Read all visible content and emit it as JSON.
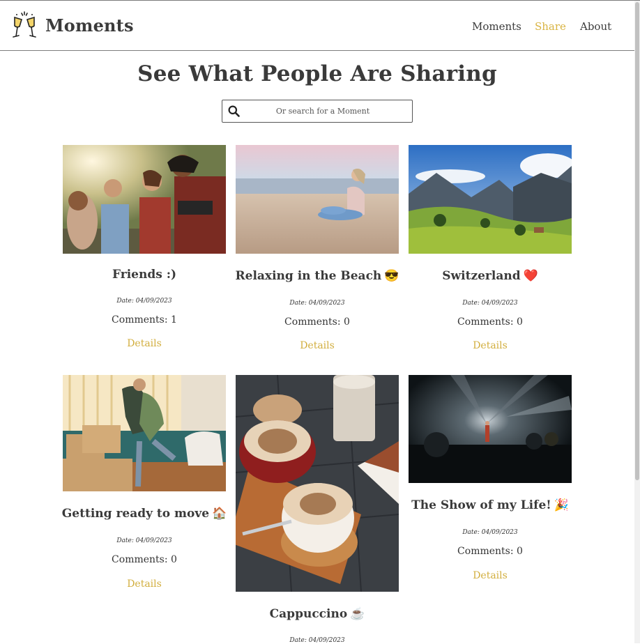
{
  "app": {
    "name": "Moments"
  },
  "nav": [
    {
      "label": "Moments",
      "active": false
    },
    {
      "label": "Share",
      "active": true
    },
    {
      "label": "About",
      "active": false
    }
  ],
  "page": {
    "title": "See What People Are Sharing"
  },
  "search": {
    "placeholder": "Or search for a Moment",
    "value": ""
  },
  "colors": {
    "accent": "#d9b443",
    "text": "#3a3a3a",
    "border": "#7d7d7d"
  },
  "cards": [
    {
      "title": "Friends :)",
      "emoji": "",
      "date": "Date: 04/09/2023",
      "comments": "Comments: 1",
      "details": "Details",
      "photo": "group of friends laughing outdoors"
    },
    {
      "title": "Relaxing in the Beach",
      "emoji": "😎",
      "date": "Date: 04/09/2023",
      "comments": "Comments: 0",
      "details": "Details",
      "photo": "woman sitting on beach sand"
    },
    {
      "title": "Switzerland",
      "emoji": "❤️",
      "date": "Date: 04/09/2023",
      "comments": "Comments: 0",
      "details": "Details",
      "photo": "alpine valley with mountains"
    },
    {
      "title": "Getting ready to move",
      "emoji": "🏠",
      "date": "Date: 04/09/2023",
      "comments": "Comments: 0",
      "details": "Details",
      "photo": "couple hugging among moving boxes"
    },
    {
      "title": "Cappuccino",
      "emoji": "☕",
      "date": "Date: 04/09/2023",
      "comments": "",
      "details": "",
      "photo": "two cappuccinos with latte art"
    },
    {
      "title": "The Show of my Life!",
      "emoji": "🎉",
      "date": "Date: 04/09/2023",
      "comments": "Comments: 0",
      "details": "Details",
      "photo": "performer on stage under lights"
    }
  ]
}
